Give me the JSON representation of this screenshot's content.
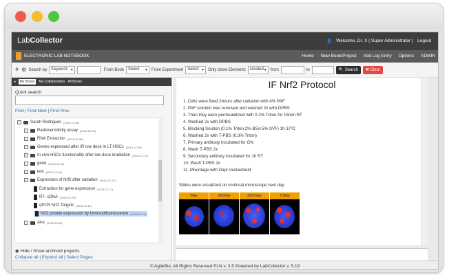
{
  "header": {
    "logo_a": "Lab",
    "logo_b": "Collector",
    "welcome": "Welcome, Dr. X ( Super Administrator )",
    "logout": "Logout"
  },
  "nav": {
    "label": "ELECTRONIC LAB NOTEBOOK",
    "menu": [
      "Home",
      "New Book/Project",
      "Add Log Entry",
      "Options",
      "ADMIN"
    ]
  },
  "search": {
    "search_by": "Search by",
    "keyword": "Keyword",
    "from_book": "From Book",
    "book_select": "Select",
    "from_experiment": "From Experiment",
    "exp_select": "Select",
    "only_show": "Only show Elements",
    "created": "created",
    "from": "from",
    "to": "to",
    "search_btn": "Search",
    "clear_btn": "Clear"
  },
  "side": {
    "tabs": [
      "My Books",
      "My Collaborators",
      "All Books"
    ],
    "quick_search": "Quick search:",
    "find": "Find | Find Next | Find Prev",
    "tree": [
      {
        "label": "Sarah Rodrigues",
        "date": "(2015-10-06)"
      },
      {
        "label": "Radiosensitivity assay",
        "date": "(2015-10-06)"
      },
      {
        "label": "RNA Extraction",
        "date": "(2015-10-06)"
      },
      {
        "label": "Genes expressed after IR low dose in LT-HSCs",
        "date": "(2015-12-08)"
      },
      {
        "label": "In vivo HSCs functionality after low dose irradiation",
        "date": "(2015-12-11)"
      },
      {
        "label": "gene",
        "date": "(2015-12-11)"
      },
      {
        "label": "test",
        "date": "(2015-12-09)"
      },
      {
        "label": "Expression of Nrf2 after radiation",
        "date": "(2015-12-17)"
      },
      {
        "label": "Extraction for gene expression",
        "date": "(2015-12-17)"
      },
      {
        "label": "RT- cDNA",
        "date": "(2015-12-29)"
      },
      {
        "label": "qPCR Nrf2 Targets",
        "date": "(2016-01-11)"
      },
      {
        "label": "Nrf2 protein expression by Immunofluorescence",
        "date": "(2016-01-11)"
      },
      {
        "label": "Ana",
        "date": "(2015-10-06)"
      }
    ],
    "archived": "Hide / Show archived projects",
    "collapse": "Collapse all | Expand all | Select Pages"
  },
  "main": {
    "title": "IF Nrf2 Protocol",
    "steps": [
      "1. Cells were fixed 2hours after radiation with 4% PAF",
      "2. PAF solution was removed and washed 2x with DPBS",
      "3. Then they were permeabilized with 0.2% Triton for 15min RT",
      "4. Washed 2x with DPBS",
      "5. Blocking Soution (0.1% Triton 2% BSA 5% SVF) 1h 37ºC",
      "6. Washed 2x with T-PBS (0.3% Triton)",
      "7. Primary antibody incubated for ON",
      "8. Wash T-PBS 2x",
      "9. Secondary antibory incubated for 1h RT",
      "10. Wash T-PBS 2x",
      "11. Mountage with Dapi-Vectashield"
    ],
    "note": "Slides were visualized on confocal microscope next day",
    "image_labels": [
      "0Gy",
      "20mGy",
      "250mGy",
      "2.5Gy"
    ]
  },
  "footer": "© AgileBio, All Rights Reserved ELN v. 3.5 Powered by LabCollector v. 5.19",
  "colors": {
    "accent": "#f0a030",
    "header": "#3d3d3d",
    "nav": "#5b5b5b",
    "search": "#2d2d2d",
    "clear": "#e04848"
  }
}
